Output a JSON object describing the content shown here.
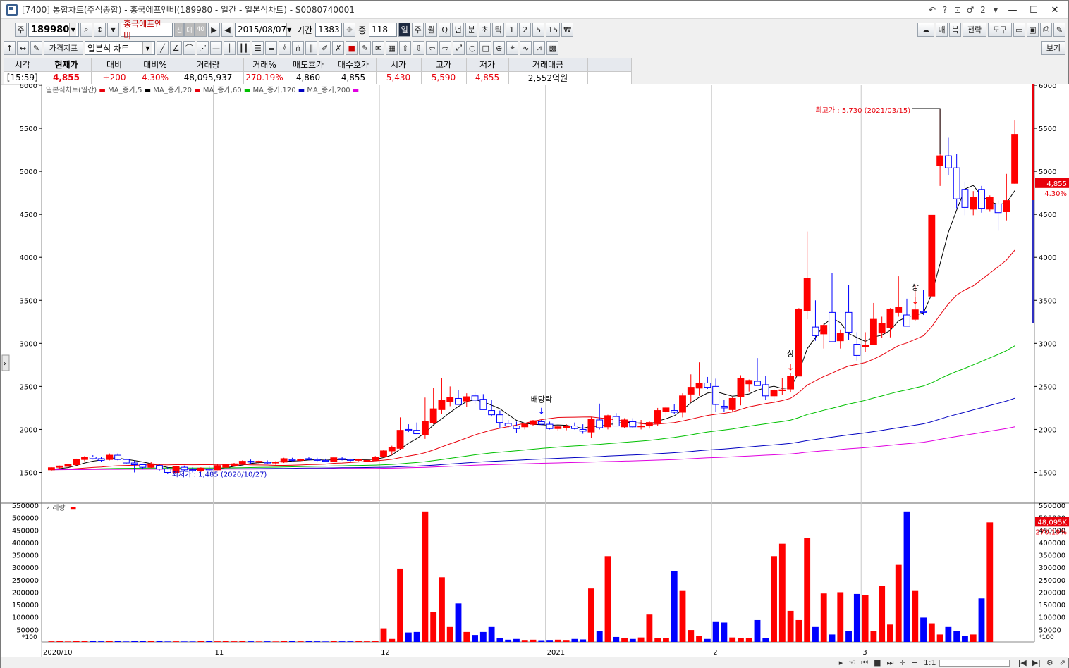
{
  "window": {
    "title": "[7400] 통합차트(주식종합) - 홍국에프엔비(189980 - 일간 - 일본식차트) - S0080740001",
    "controls": [
      "↶",
      "?",
      "⊡",
      "♂",
      "2",
      "▾"
    ],
    "min": "—",
    "max": "☐",
    "close": "✕"
  },
  "toolbar1": {
    "market": "주",
    "code": "189980",
    "stock_name": "홍국에프엔비",
    "badges": [
      "신",
      "대",
      "40"
    ],
    "date": "2015/08/07",
    "period_label": "기간",
    "period_value": "1383",
    "count_label": "종",
    "count_value": "118",
    "timeframes": [
      "일",
      "주",
      "월",
      "Q",
      "년",
      "분",
      "초",
      "틱",
      "1",
      "2",
      "5",
      "15",
      "₩"
    ],
    "right_buttons": [
      "매",
      "복",
      "전략",
      "도구"
    ]
  },
  "toolbar2": {
    "indicator_btn": "가격지표",
    "chart_type": "일본식 차트",
    "view_btn": "보기"
  },
  "quote": {
    "headers": [
      "시각",
      "현재가",
      "대비",
      "대비%",
      "거래량",
      "거래%",
      "매도호가",
      "매수호가",
      "시가",
      "고가",
      "저가",
      "거래대금"
    ],
    "values": [
      "[15:59]",
      "4,855",
      "+200",
      "4.30%",
      "48,095,937",
      "270.19%",
      "4,860",
      "4,855",
      "5,430",
      "5,590",
      "4,855",
      "2,552억원"
    ]
  },
  "chart_data": {
    "type": "candlestick",
    "legend": [
      "일본식차트(일간)",
      "MA_종가,5",
      "MA_종가,20",
      "MA_종가,60",
      "MA_종가,120",
      "MA_종가,200"
    ],
    "legend_colors": [
      "#e8000b",
      "#000000",
      "#e8000b",
      "#00c000",
      "#0000c0",
      "#e000e0"
    ],
    "y_ticks": [
      1500,
      2000,
      2500,
      3000,
      3500,
      4000,
      4500,
      5000,
      5500,
      6000
    ],
    "y_tick_labels": [
      "1500",
      "2000",
      "2500",
      "3000",
      "3500",
      "4000",
      "4500",
      "5000",
      "5500",
      "6000"
    ],
    "ylim": [
      1160,
      6000
    ],
    "x_labels": [
      "2020/10",
      "11",
      "12",
      "2021",
      "2",
      "3"
    ],
    "x_label_index": [
      0,
      20,
      40,
      60,
      80,
      98
    ],
    "annotations": {
      "high": "최고가 : 5,730 (2021/03/15)",
      "low": "최저가 : 1,485 (2020/10/27)",
      "dividend": "배당락",
      "limit_up": "상"
    },
    "current_price_label": "4,855",
    "current_pct_label": "4.30%",
    "candles": [
      {
        "o": 1530,
        "h": 1560,
        "l": 1515,
        "c": 1555
      },
      {
        "o": 1560,
        "h": 1580,
        "l": 1540,
        "c": 1575
      },
      {
        "o": 1570,
        "h": 1600,
        "l": 1560,
        "c": 1590
      },
      {
        "o": 1590,
        "h": 1660,
        "l": 1580,
        "c": 1650
      },
      {
        "o": 1650,
        "h": 1690,
        "l": 1630,
        "c": 1680
      },
      {
        "o": 1680,
        "h": 1700,
        "l": 1650,
        "c": 1660
      },
      {
        "o": 1660,
        "h": 1680,
        "l": 1620,
        "c": 1640
      },
      {
        "o": 1650,
        "h": 1720,
        "l": 1640,
        "c": 1700
      },
      {
        "o": 1700,
        "h": 1720,
        "l": 1640,
        "c": 1650
      },
      {
        "o": 1650,
        "h": 1660,
        "l": 1600,
        "c": 1610
      },
      {
        "o": 1610,
        "h": 1640,
        "l": 1500,
        "c": 1590
      },
      {
        "o": 1590,
        "h": 1600,
        "l": 1540,
        "c": 1560
      },
      {
        "o": 1560,
        "h": 1620,
        "l": 1550,
        "c": 1600
      },
      {
        "o": 1580,
        "h": 1600,
        "l": 1520,
        "c": 1540
      },
      {
        "o": 1540,
        "h": 1560,
        "l": 1485,
        "c": 1500
      },
      {
        "o": 1500,
        "h": 1590,
        "l": 1495,
        "c": 1570
      },
      {
        "o": 1560,
        "h": 1580,
        "l": 1510,
        "c": 1530
      },
      {
        "o": 1530,
        "h": 1560,
        "l": 1500,
        "c": 1520
      },
      {
        "o": 1520,
        "h": 1560,
        "l": 1505,
        "c": 1550
      },
      {
        "o": 1540,
        "h": 1570,
        "l": 1520,
        "c": 1530
      },
      {
        "o": 1530,
        "h": 1590,
        "l": 1525,
        "c": 1580
      },
      {
        "o": 1560,
        "h": 1600,
        "l": 1550,
        "c": 1590
      },
      {
        "o": 1580,
        "h": 1610,
        "l": 1570,
        "c": 1600
      },
      {
        "o": 1600,
        "h": 1640,
        "l": 1590,
        "c": 1630
      },
      {
        "o": 1630,
        "h": 1650,
        "l": 1600,
        "c": 1620
      },
      {
        "o": 1620,
        "h": 1640,
        "l": 1600,
        "c": 1630
      },
      {
        "o": 1620,
        "h": 1640,
        "l": 1600,
        "c": 1610
      },
      {
        "o": 1610,
        "h": 1630,
        "l": 1590,
        "c": 1620
      },
      {
        "o": 1620,
        "h": 1670,
        "l": 1610,
        "c": 1660
      },
      {
        "o": 1650,
        "h": 1670,
        "l": 1630,
        "c": 1640
      },
      {
        "o": 1640,
        "h": 1660,
        "l": 1630,
        "c": 1650
      },
      {
        "o": 1660,
        "h": 1680,
        "l": 1640,
        "c": 1650
      },
      {
        "o": 1650,
        "h": 1670,
        "l": 1630,
        "c": 1640
      },
      {
        "o": 1640,
        "h": 1660,
        "l": 1620,
        "c": 1630
      },
      {
        "o": 1630,
        "h": 1680,
        "l": 1620,
        "c": 1670
      },
      {
        "o": 1660,
        "h": 1680,
        "l": 1640,
        "c": 1650
      },
      {
        "o": 1650,
        "h": 1660,
        "l": 1620,
        "c": 1640
      },
      {
        "o": 1640,
        "h": 1660,
        "l": 1630,
        "c": 1650
      },
      {
        "o": 1630,
        "h": 1650,
        "l": 1620,
        "c": 1640
      },
      {
        "o": 1640,
        "h": 1690,
        "l": 1640,
        "c": 1680
      },
      {
        "o": 1680,
        "h": 1760,
        "l": 1670,
        "c": 1750
      },
      {
        "o": 1750,
        "h": 1810,
        "l": 1700,
        "c": 1790
      },
      {
        "o": 1780,
        "h": 2140,
        "l": 1770,
        "c": 1990
      },
      {
        "o": 2000,
        "h": 2060,
        "l": 1970,
        "c": 1990
      },
      {
        "o": 1990,
        "h": 2080,
        "l": 1960,
        "c": 1950
      },
      {
        "o": 1940,
        "h": 2370,
        "l": 1890,
        "c": 2090
      },
      {
        "o": 2080,
        "h": 2480,
        "l": 2060,
        "c": 2240
      },
      {
        "o": 2230,
        "h": 2600,
        "l": 2180,
        "c": 2340
      },
      {
        "o": 2320,
        "h": 2500,
        "l": 2270,
        "c": 2370
      },
      {
        "o": 2360,
        "h": 2460,
        "l": 2320,
        "c": 2290
      },
      {
        "o": 2330,
        "h": 2420,
        "l": 2260,
        "c": 2380
      },
      {
        "o": 2390,
        "h": 2430,
        "l": 2300,
        "c": 2340
      },
      {
        "o": 2350,
        "h": 2410,
        "l": 2240,
        "c": 2230
      },
      {
        "o": 2220,
        "h": 2340,
        "l": 2150,
        "c": 2170
      },
      {
        "o": 2170,
        "h": 2220,
        "l": 2020,
        "c": 2080
      },
      {
        "o": 2070,
        "h": 2110,
        "l": 2020,
        "c": 2040
      },
      {
        "o": 2040,
        "h": 2090,
        "l": 1960,
        "c": 2010
      },
      {
        "o": 2030,
        "h": 2070,
        "l": 2000,
        "c": 2060
      },
      {
        "o": 2060,
        "h": 2110,
        "l": 2040,
        "c": 2100
      },
      {
        "o": 2090,
        "h": 2110,
        "l": 2050,
        "c": 2060
      },
      {
        "o": 2060,
        "h": 2090,
        "l": 2000,
        "c": 2010
      },
      {
        "o": 2010,
        "h": 2050,
        "l": 1980,
        "c": 2030
      },
      {
        "o": 2020,
        "h": 2060,
        "l": 1990,
        "c": 2040
      },
      {
        "o": 2040,
        "h": 2080,
        "l": 2000,
        "c": 2010
      },
      {
        "o": 2000,
        "h": 2060,
        "l": 1950,
        "c": 1980
      },
      {
        "o": 1970,
        "h": 2140,
        "l": 1900,
        "c": 2120
      },
      {
        "o": 2110,
        "h": 2300,
        "l": 2000,
        "c": 2020
      },
      {
        "o": 2030,
        "h": 2170,
        "l": 2000,
        "c": 2160
      },
      {
        "o": 2150,
        "h": 2190,
        "l": 2040,
        "c": 2040
      },
      {
        "o": 2030,
        "h": 2130,
        "l": 2020,
        "c": 2110
      },
      {
        "o": 2090,
        "h": 2130,
        "l": 2020,
        "c": 2030
      },
      {
        "o": 2030,
        "h": 2110,
        "l": 2000,
        "c": 2040
      },
      {
        "o": 2040,
        "h": 2100,
        "l": 2010,
        "c": 2080
      },
      {
        "o": 2070,
        "h": 2250,
        "l": 2040,
        "c": 2220
      },
      {
        "o": 2210,
        "h": 2270,
        "l": 2160,
        "c": 2250
      },
      {
        "o": 2220,
        "h": 2290,
        "l": 2180,
        "c": 2200
      },
      {
        "o": 2200,
        "h": 2420,
        "l": 2140,
        "c": 2390
      },
      {
        "o": 2410,
        "h": 2640,
        "l": 2320,
        "c": 2490
      },
      {
        "o": 2480,
        "h": 2780,
        "l": 2390,
        "c": 2540
      },
      {
        "o": 2540,
        "h": 2610,
        "l": 2470,
        "c": 2490
      },
      {
        "o": 2500,
        "h": 2590,
        "l": 2200,
        "c": 2290
      },
      {
        "o": 2270,
        "h": 2340,
        "l": 2200,
        "c": 2250
      },
      {
        "o": 2230,
        "h": 2380,
        "l": 2210,
        "c": 2360
      },
      {
        "o": 2380,
        "h": 2630,
        "l": 2280,
        "c": 2590
      },
      {
        "o": 2530,
        "h": 2580,
        "l": 2440,
        "c": 2570
      },
      {
        "o": 2560,
        "h": 2830,
        "l": 2510,
        "c": 2510
      },
      {
        "o": 2520,
        "h": 2620,
        "l": 2340,
        "c": 2390
      },
      {
        "o": 2390,
        "h": 2490,
        "l": 2320,
        "c": 2450
      },
      {
        "o": 2450,
        "h": 2600,
        "l": 2400,
        "c": 2460
      },
      {
        "o": 2470,
        "h": 2650,
        "l": 2430,
        "c": 2620
      },
      {
        "o": 2620,
        "h": 3410,
        "l": 2620,
        "c": 3400
      },
      {
        "o": 3380,
        "h": 4300,
        "l": 3280,
        "c": 3760
      },
      {
        "o": 3190,
        "h": 3500,
        "l": 3030,
        "c": 3090
      },
      {
        "o": 3110,
        "h": 3230,
        "l": 2940,
        "c": 3210
      },
      {
        "o": 3360,
        "h": 3820,
        "l": 3050,
        "c": 3020
      },
      {
        "o": 3030,
        "h": 3160,
        "l": 2940,
        "c": 3120
      },
      {
        "o": 3360,
        "h": 3680,
        "l": 3040,
        "c": 3130
      },
      {
        "o": 2990,
        "h": 3130,
        "l": 2800,
        "c": 2860
      },
      {
        "o": 2960,
        "h": 3130,
        "l": 2900,
        "c": 2980
      },
      {
        "o": 2990,
        "h": 3470,
        "l": 2990,
        "c": 3280
      },
      {
        "o": 3120,
        "h": 3310,
        "l": 3060,
        "c": 3230
      },
      {
        "o": 3180,
        "h": 3410,
        "l": 3070,
        "c": 3400
      },
      {
        "o": 3360,
        "h": 3780,
        "l": 3310,
        "c": 3420
      },
      {
        "o": 3330,
        "h": 3520,
        "l": 3270,
        "c": 3200
      },
      {
        "o": 3280,
        "h": 3680,
        "l": 3260,
        "c": 3390
      },
      {
        "o": 3370,
        "h": 3620,
        "l": 3330,
        "c": 3360
      },
      {
        "o": 3550,
        "h": 4490,
        "l": 3550,
        "c": 4490
      },
      {
        "o": 5070,
        "h": 5730,
        "l": 4830,
        "c": 5180
      },
      {
        "o": 5180,
        "h": 5390,
        "l": 4960,
        "c": 5040
      },
      {
        "o": 5040,
        "h": 5200,
        "l": 4570,
        "c": 4680
      },
      {
        "o": 4790,
        "h": 4880,
        "l": 4490,
        "c": 4580
      },
      {
        "o": 4560,
        "h": 4770,
        "l": 4490,
        "c": 4700
      },
      {
        "o": 4790,
        "h": 4830,
        "l": 4520,
        "c": 4570
      },
      {
        "o": 4560,
        "h": 4720,
        "l": 4530,
        "c": 4700
      },
      {
        "o": 4620,
        "h": 4660,
        "l": 4310,
        "c": 4520
      },
      {
        "o": 4530,
        "h": 4970,
        "l": 4430,
        "c": 4660
      },
      {
        "o": 4860,
        "h": 5590,
        "l": 4855,
        "c": 5430
      }
    ],
    "ma5_label": "MA_종가,5",
    "volume": {
      "title": "거래량",
      "y_ticks": [
        50000,
        100000,
        150000,
        200000,
        250000,
        300000,
        350000,
        400000,
        450000,
        500000,
        550000
      ],
      "y_tick_labels": [
        "50000",
        "100000",
        "150000",
        "200000",
        "250000",
        "300000",
        "350000",
        "400000",
        "450000",
        "500000",
        "550000"
      ],
      "ylim": [
        0,
        550000
      ],
      "unit_label": "*100",
      "current_label": "48,095K",
      "current_pct": "270.19%",
      "values": [
        2500,
        3000,
        2000,
        4000,
        3500,
        3000,
        2500,
        5000,
        3000,
        2000,
        4000,
        3000,
        3000,
        4000,
        2000,
        2500,
        2000,
        2000,
        3000,
        3000,
        2500,
        3000,
        2500,
        3000,
        2500,
        2000,
        2500,
        2000,
        3000,
        3000,
        2500,
        3000,
        2500,
        2000,
        3000,
        2500,
        2500,
        3000,
        2500,
        3500,
        55000,
        12000,
        295000,
        38000,
        40000,
        525000,
        120000,
        260000,
        60000,
        155000,
        40000,
        28000,
        40000,
        60000,
        15000,
        9000,
        12000,
        8000,
        9000,
        7000,
        8000,
        9000,
        8000,
        12000,
        10000,
        215000,
        45000,
        345000,
        20000,
        15000,
        12000,
        18000,
        110000,
        15000,
        15000,
        285000,
        205000,
        48000,
        25000,
        12000,
        80000,
        78000,
        18000,
        15000,
        15000,
        88000,
        15000,
        345000,
        395000,
        125000,
        88000,
        418000,
        60000,
        195000,
        30000,
        200000,
        45000,
        193000,
        188000,
        45000,
        225000,
        70000,
        310000,
        525000,
        205000,
        98000,
        75000,
        30000,
        60000,
        45000,
        25000,
        30000,
        175000,
        481000
      ]
    }
  }
}
